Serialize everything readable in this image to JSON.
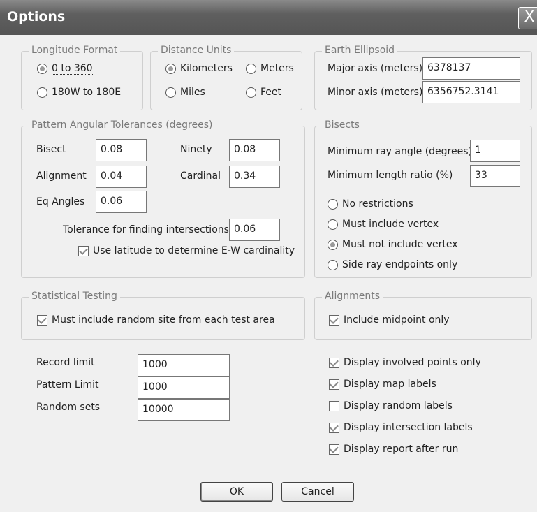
{
  "window": {
    "title": "Options",
    "close_glyph": "X"
  },
  "longitude_format": {
    "legend": "Longitude Format",
    "options": [
      "0 to 360",
      "180W to 180E"
    ],
    "selected": "0 to 360"
  },
  "distance_units": {
    "legend": "Distance Units",
    "options": [
      "Kilometers",
      "Meters",
      "Miles",
      "Feet"
    ],
    "selected": "Kilometers"
  },
  "earth_ellipsoid": {
    "legend": "Earth Ellipsoid",
    "major_label": "Major axis (meters)",
    "major_value": "6378137",
    "minor_label": "Minor axis (meters)",
    "minor_value": "6356752.3141"
  },
  "pattern_tolerances": {
    "legend": "Pattern Angular Tolerances (degrees)",
    "bisect_label": "Bisect",
    "bisect_value": "0.08",
    "ninety_label": "Ninety",
    "ninety_value": "0.08",
    "alignment_label": "Alignment",
    "alignment_value": "0.04",
    "cardinal_label": "Cardinal",
    "cardinal_value": "0.34",
    "eq_angles_label": "Eq Angles",
    "eq_angles_value": "0.06",
    "intersection_label": "Tolerance for finding intersections",
    "intersection_value": "0.06",
    "latitude_check_label": "Use latitude to determine E-W cardinality",
    "latitude_checked": true
  },
  "bisects": {
    "legend": "Bisects",
    "min_ray_label": "Minimum ray angle (degrees)",
    "min_ray_value": "1",
    "min_length_label": "Minimum length ratio (%)",
    "min_length_value": "33",
    "options": [
      "No restrictions",
      "Must include vertex",
      "Must not include vertex",
      "Side ray endpoints only"
    ],
    "selected": "Must not include vertex"
  },
  "statistical_testing": {
    "legend": "Statistical Testing",
    "check_label": "Must include random site from each test area",
    "checked": true
  },
  "alignments": {
    "legend": "Alignments",
    "check_label": "Include midpoint only",
    "checked": true
  },
  "limits": {
    "record_label": "Record limit",
    "record_value": "1000",
    "pattern_label": "Pattern Limit",
    "pattern_value": "1000",
    "random_label": "Random sets",
    "random_value": "10000"
  },
  "display_options": [
    {
      "label": "Display involved points only",
      "checked": true
    },
    {
      "label": "Display map labels",
      "checked": true
    },
    {
      "label": "Display random labels",
      "checked": false
    },
    {
      "label": "Display intersection labels",
      "checked": true
    },
    {
      "label": "Display report after run",
      "checked": true
    }
  ],
  "buttons": {
    "ok": "OK",
    "cancel": "Cancel"
  }
}
